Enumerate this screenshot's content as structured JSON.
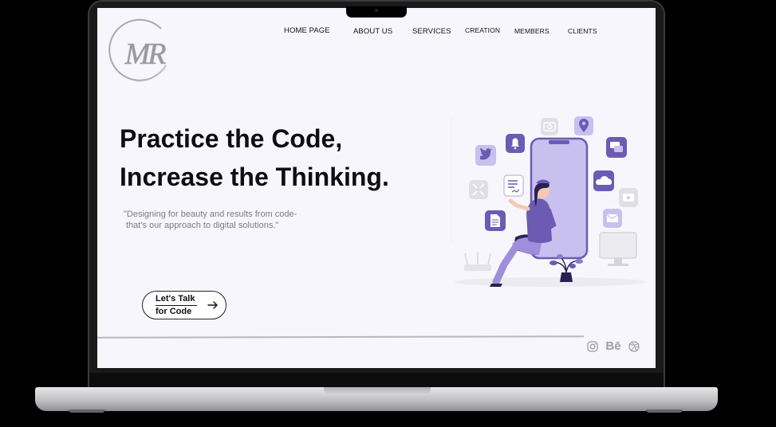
{
  "brand": {
    "logo_text": "MR"
  },
  "nav": {
    "items": [
      "HOME PAGE",
      "ABOUT US",
      "SERVICES",
      "CREATION",
      "MEMBERS",
      "CLIENTS"
    ]
  },
  "hero": {
    "title_line1": "Practice the Code,",
    "title_line2": "Increase the Thinking.",
    "tagline_line1": "\"Designing for beauty and results from code-",
    "tagline_line2": "that's our approach to digital solutions.\""
  },
  "cta": {
    "line1": "Let's Talk",
    "line2": "for Code"
  },
  "social": {
    "icons": [
      "instagram-icon",
      "behance-icon",
      "dribbble-icon"
    ],
    "behance_text": "Bē"
  },
  "colors": {
    "accent": "#6b5bb3",
    "accent_light": "#c9c1ee",
    "screen_bg": "#f7f6fc",
    "text": "#0e0e12"
  }
}
